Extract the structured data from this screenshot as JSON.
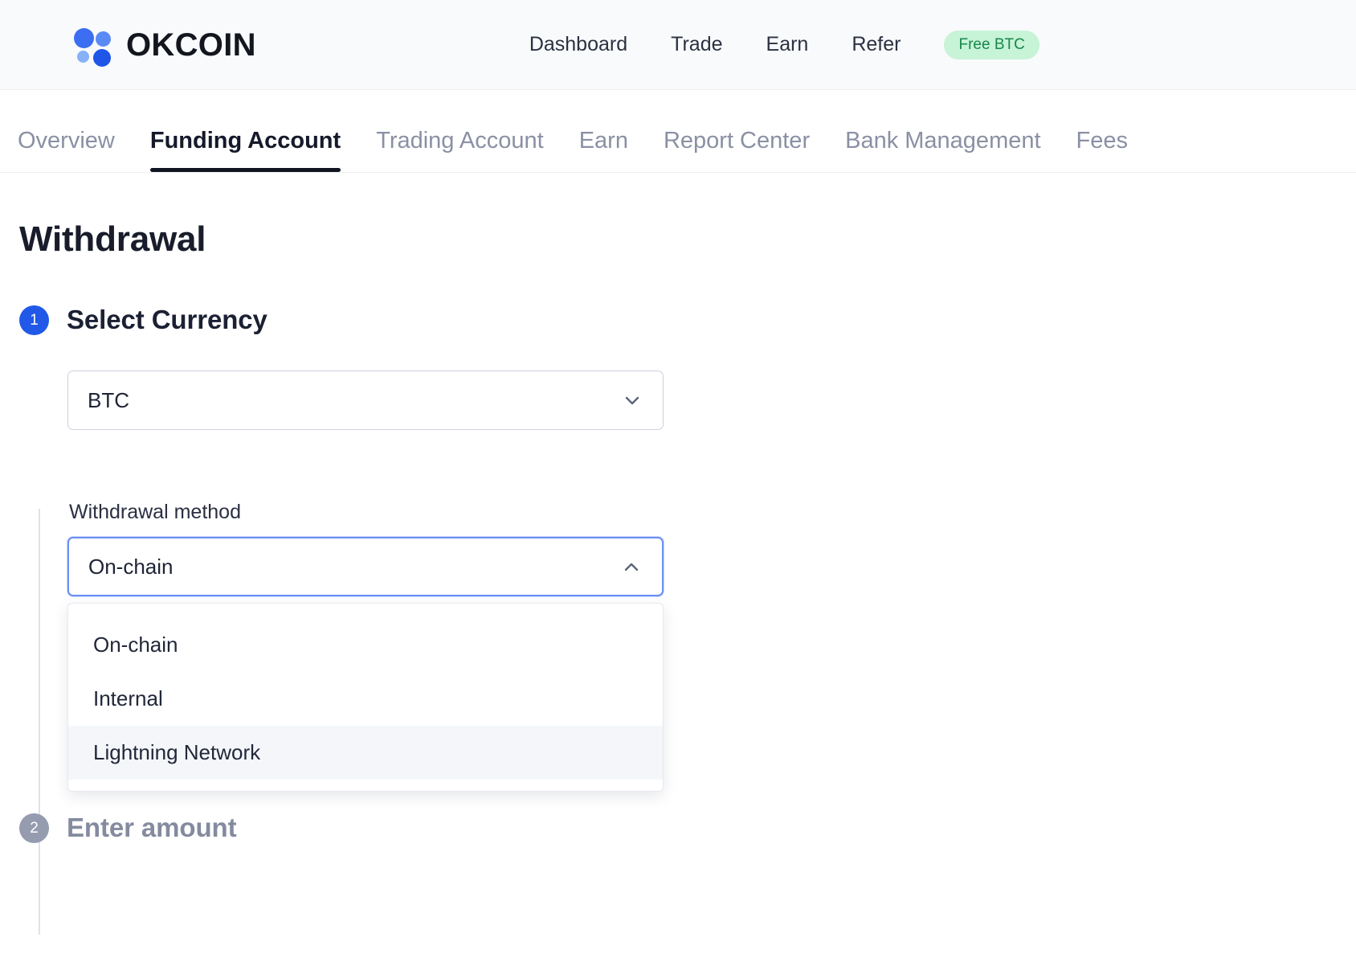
{
  "header": {
    "brand_name": "OKCOIN",
    "logo_icon": "okcoin-dots-logo",
    "nav": [
      {
        "label": "Dashboard"
      },
      {
        "label": "Trade"
      },
      {
        "label": "Earn"
      },
      {
        "label": "Refer"
      }
    ],
    "badge": {
      "label": "Free BTC",
      "bg_color": "#c7f3d7",
      "text_color": "#17874a"
    }
  },
  "subtabs": [
    {
      "label": "Overview",
      "active": false
    },
    {
      "label": "Funding Account",
      "active": true
    },
    {
      "label": "Trading Account",
      "active": false
    },
    {
      "label": "Earn",
      "active": false
    },
    {
      "label": "Report Center",
      "active": false
    },
    {
      "label": "Bank Management",
      "active": false
    },
    {
      "label": "Fees",
      "active": false
    }
  ],
  "page": {
    "title": "Withdrawal"
  },
  "steps": [
    {
      "number": "1",
      "label": "Select Currency",
      "state": "active",
      "accent_color": "#2158e8"
    },
    {
      "number": "2",
      "label": "Enter amount",
      "state": "inactive",
      "accent_color": "#959cb0"
    }
  ],
  "currency_select": {
    "value": "BTC",
    "icon": "chevron-down-icon",
    "expanded": false
  },
  "method_select": {
    "label": "Withdrawal method",
    "value": "On-chain",
    "icon": "chevron-up-icon",
    "expanded": true,
    "focus_border_color": "#6b90f5",
    "options": [
      {
        "label": "On-chain",
        "highlighted": false
      },
      {
        "label": "Internal",
        "highlighted": false
      },
      {
        "label": "Lightning Network",
        "highlighted": true
      }
    ]
  }
}
